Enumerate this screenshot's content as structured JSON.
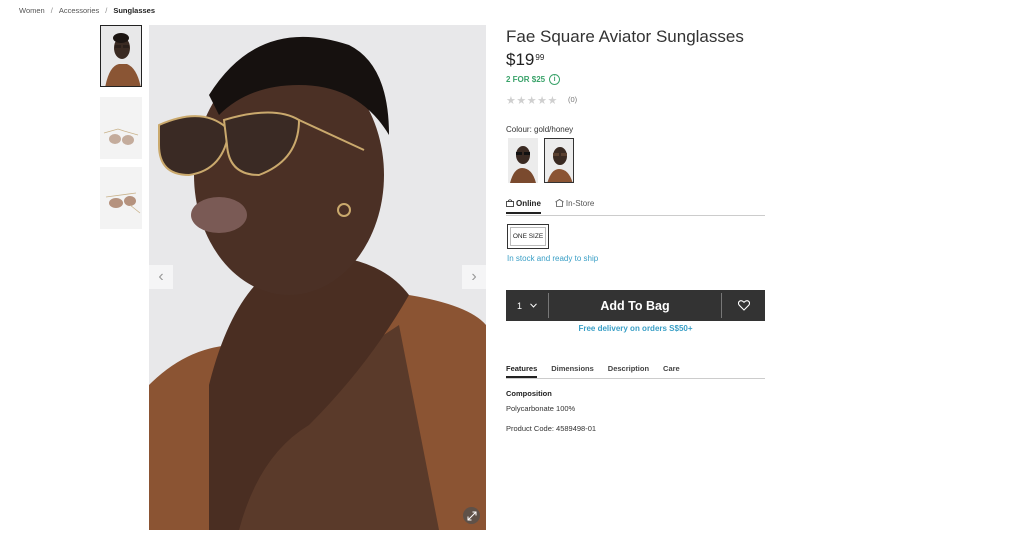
{
  "breadcrumb": {
    "items": [
      "Women",
      "Accessories",
      "Sunglasses"
    ],
    "separator": "/"
  },
  "product": {
    "title": "Fae Square Aviator Sunglasses",
    "price_main": "$19",
    "price_cents": "99",
    "promo": "2 FOR $25",
    "promo_info_icon": "i",
    "rating_stars": "★★★★★",
    "rating_value": 0,
    "review_count": "(0)",
    "colour_label": "Colour:",
    "colour_value": "gold/honey",
    "swatch_count": 2,
    "selected_swatch": 2
  },
  "availability_tabs": {
    "online": "Online",
    "instore": "In-Store"
  },
  "size": {
    "label": "ONE SIZE"
  },
  "stock_status": "In stock and ready to ship",
  "cart": {
    "quantity": "1",
    "add_label": "Add To Bag"
  },
  "delivery_note": "Free delivery on orders S$50+",
  "info_tabs": [
    "Features",
    "Dimensions",
    "Description",
    "Care"
  ],
  "features": {
    "composition_heading": "Composition",
    "composition_value": "Polycarbonate 100%",
    "product_code": "Product Code: 4589498-01"
  },
  "gallery": {
    "arrow_prev": "‹",
    "arrow_next": "›",
    "thumb_count": 3,
    "active_thumb": 1
  },
  "colors": {
    "promo_green": "#3aa36a",
    "link_blue": "#3a9fc6",
    "bag_bar": "#333333"
  }
}
